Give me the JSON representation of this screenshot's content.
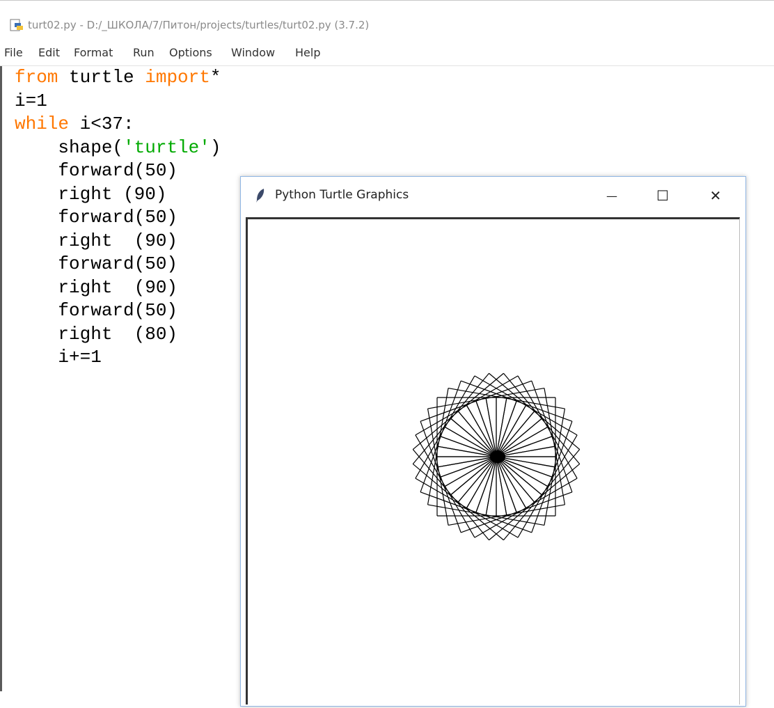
{
  "idle": {
    "title": "turt02.py - D:/_ШКОЛА/7/Питон/projects/turtles/turt02.py (3.7.2)",
    "menu": [
      "File",
      "Edit",
      "Format",
      "Run",
      "Options",
      "Window",
      "Help"
    ],
    "code": [
      {
        "parts": [
          {
            "t": "from",
            "c": "kw"
          },
          {
            "t": " turtle ",
            "c": ""
          },
          {
            "t": "import",
            "c": "kw"
          },
          {
            "t": "*",
            "c": ""
          }
        ]
      },
      {
        "parts": [
          {
            "t": "i=1",
            "c": ""
          }
        ]
      },
      {
        "parts": [
          {
            "t": "while",
            "c": "kw"
          },
          {
            "t": " i<37:",
            "c": ""
          }
        ]
      },
      {
        "parts": [
          {
            "t": "    shape(",
            "c": ""
          },
          {
            "t": "'turtle'",
            "c": "str"
          },
          {
            "t": ")",
            "c": ""
          }
        ]
      },
      {
        "parts": [
          {
            "t": "    forward(50)",
            "c": ""
          }
        ]
      },
      {
        "parts": [
          {
            "t": "    right (90)",
            "c": ""
          }
        ]
      },
      {
        "parts": [
          {
            "t": "    forward(50)",
            "c": ""
          }
        ]
      },
      {
        "parts": [
          {
            "t": "    right  (90)",
            "c": ""
          }
        ]
      },
      {
        "parts": [
          {
            "t": "    forward(50)",
            "c": ""
          }
        ]
      },
      {
        "parts": [
          {
            "t": "    right  (90)",
            "c": ""
          }
        ]
      },
      {
        "parts": [
          {
            "t": "    forward(50)",
            "c": ""
          }
        ]
      },
      {
        "parts": [
          {
            "t": "    right  (80)",
            "c": ""
          }
        ]
      },
      {
        "parts": [
          {
            "t": "    i+=1",
            "c": ""
          }
        ]
      }
    ],
    "colors": {
      "keyword": "#ff7700",
      "string": "#00aa00"
    }
  },
  "turtle_window": {
    "title": "Python Turtle Graphics",
    "minimize_glyph": "—",
    "maximize_glyph": "☐",
    "close_glyph": "✕",
    "drawing": {
      "squares": 36,
      "side": 50,
      "turn_per_square": 10,
      "line_color": "#000000"
    }
  }
}
